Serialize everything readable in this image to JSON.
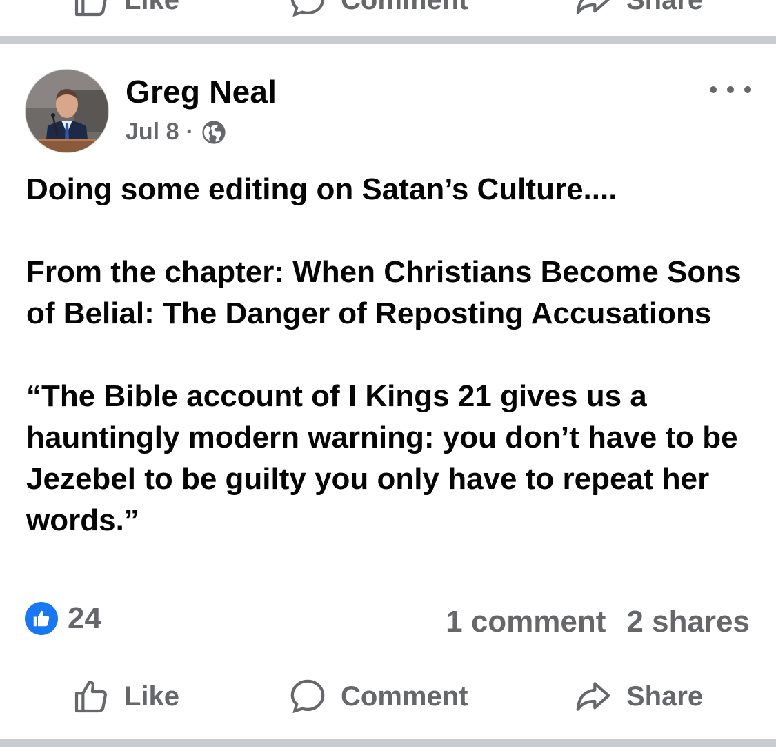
{
  "previous_post": {
    "actions": {
      "like": "Like",
      "comment": "Comment",
      "share": "Share"
    }
  },
  "post": {
    "author": {
      "name": "Greg Neal"
    },
    "date": "Jul 8",
    "separator": "·",
    "audience_icon": "globe-icon",
    "body": [
      "Doing some editing on Satan’s Culture....",
      "From the chapter: When Christians Become Sons of Belial: The Danger of Reposting Accusations",
      "“The Bible account of I Kings 21 gives us a hauntingly modern warning: you don’t have to be Jezebel to be guilty you only have to repeat her words.”"
    ],
    "reaction_count": "24",
    "comments": "1 comment",
    "shares": "2 shares",
    "actions": {
      "like": "Like",
      "comment": "Comment",
      "share": "Share"
    }
  },
  "colors": {
    "text_primary": "#050505",
    "text_secondary": "#65676b",
    "separator": "#c9ccd1",
    "like_blue": "#1877f2"
  }
}
